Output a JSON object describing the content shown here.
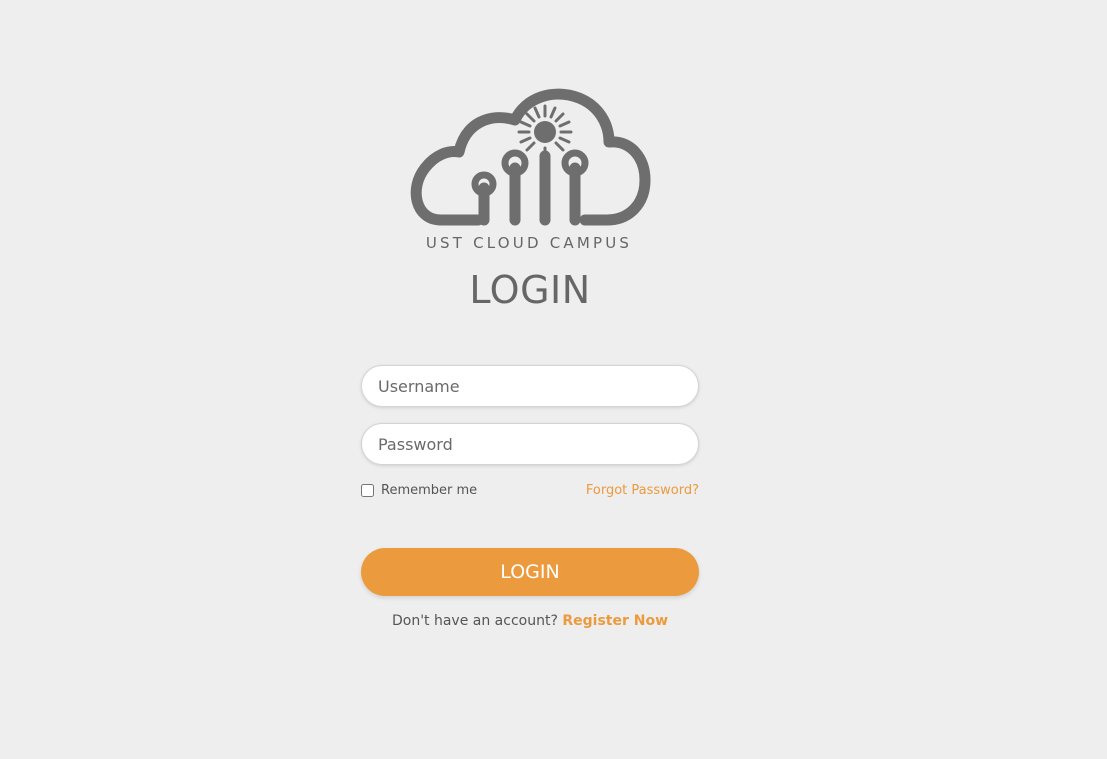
{
  "logo": {
    "text": "UST CLOUD CAMPUS",
    "icon": "cloud-circuit-icon",
    "color": "#666666"
  },
  "title": "LOGIN",
  "form": {
    "username_placeholder": "Username",
    "password_placeholder": "Password",
    "remember_label": "Remember me",
    "remember_checked": false,
    "forgot_label": "Forgot Password?",
    "submit_label": "LOGIN"
  },
  "register": {
    "prompt": "Don't have an account?",
    "link_label": "Register Now"
  },
  "colors": {
    "accent": "#ec9a3e",
    "background": "#eeeeee",
    "text": "#666666"
  }
}
